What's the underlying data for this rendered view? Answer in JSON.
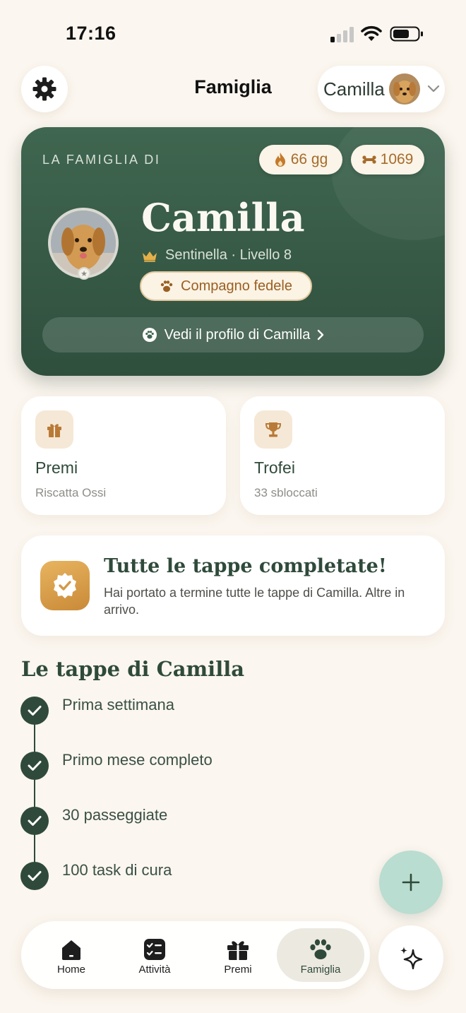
{
  "status_bar": {
    "time": "17:16"
  },
  "header": {
    "title": "Famiglia",
    "pet_switcher": {
      "name": "Camilla",
      "icon": "chevron-down-icon"
    }
  },
  "hero": {
    "kicker": "LA FAMIGLIA DI",
    "streak": "66 gg",
    "bones": "1069",
    "pet_name": "Camilla",
    "rank": "Sentinella · Livello 8",
    "title_badge": "Compagno fedele",
    "profile_button": "Vedi il profilo di Camilla"
  },
  "quick_cards": [
    {
      "title": "Premi",
      "subtitle": "Riscatta Ossi",
      "icon": "gift-icon"
    },
    {
      "title": "Trofei",
      "subtitle": "33 sbloccati",
      "icon": "trophy-icon"
    }
  ],
  "completion": {
    "title": "Tutte le tappe completate!",
    "text": "Hai portato a termine tutte le tappe di Camilla. Altre in arrivo."
  },
  "milestones": {
    "title": "Le tappe di Camilla",
    "items": [
      {
        "label": "Prima settimana"
      },
      {
        "label": "Primo mese completo"
      },
      {
        "label": "30 passeggiate"
      },
      {
        "label": "100 task di cura"
      }
    ]
  },
  "tabbar": {
    "items": [
      {
        "label": "Home",
        "icon": "home-icon"
      },
      {
        "label": "Attività",
        "icon": "checklist-icon"
      },
      {
        "label": "Premi",
        "icon": "gift-icon"
      },
      {
        "label": "Famiglia",
        "icon": "paw-icon"
      }
    ],
    "active": "Famiglia"
  },
  "colors": {
    "background": "#fbf6ef",
    "hero_green": "#3f6650",
    "accent_brown": "#a66b2a",
    "fab_mint": "#b9ddd0"
  }
}
